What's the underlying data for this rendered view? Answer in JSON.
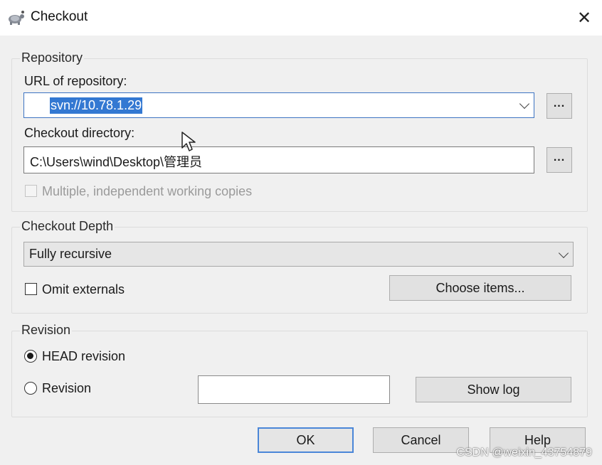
{
  "window": {
    "title": "Checkout",
    "close_glyph": "✕",
    "icon": "tortoise-icon"
  },
  "repository": {
    "group_label": "Repository",
    "url_label": "URL of repository:",
    "url_value": "svn://10.78.1.29",
    "browse_label": "...",
    "dir_label": "Checkout directory:",
    "dir_value": "C:\\Users\\wind\\Desktop\\管理员",
    "dir_browse_label": "...",
    "multiple_copies_label": "Multiple, independent working copies",
    "multiple_copies_checked": false,
    "multiple_copies_enabled": false
  },
  "depth": {
    "group_label": "Checkout Depth",
    "selected": "Fully recursive",
    "omit_externals_label": "Omit externals",
    "omit_externals_checked": false,
    "choose_items_label": "Choose items..."
  },
  "revision": {
    "group_label": "Revision",
    "head_label": "HEAD revision",
    "head_selected": true,
    "revision_label": "Revision",
    "revision_value": "",
    "show_log_label": "Show log"
  },
  "buttons": {
    "ok": "OK",
    "cancel": "Cancel",
    "help": "Help"
  },
  "watermark": "CSDN @weixin_43754879",
  "colors": {
    "selection": "#3378d2",
    "focus_border": "#4a86d8"
  }
}
